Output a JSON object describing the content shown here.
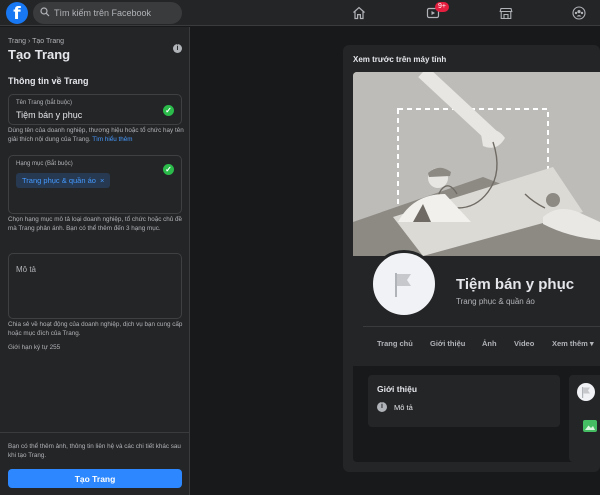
{
  "topbar": {
    "logo": "f",
    "search_placeholder": "Tìm kiếm trên Facebook",
    "nav_icons": [
      "home-icon",
      "watch-icon",
      "marketplace-icon",
      "groups-icon"
    ],
    "watch_badge": "9+"
  },
  "form": {
    "breadcrumb": "Trang › Tạo Trang",
    "title": "Tạo Trang",
    "section_title": "Thông tin về Trang",
    "name_field": {
      "label": "Tên Trang (bắt buộc)",
      "value": "Tiệm bán y phục"
    },
    "name_help": "Dùng tên của doanh nghiệp, thương hiệu hoặc tổ chức hay tên giải thích nội dung của Trang.",
    "name_help_link": "Tìm hiểu thêm",
    "category_field": {
      "label": "Hạng mục (Bắt buộc)",
      "chip": "Trang phục & quần áo",
      "chip_remove": "×"
    },
    "category_help": "Chọn hạng mục mô tả loại doanh nghiệp, tổ chức hoặc chủ đề mà Trang phản ánh. Bạn có thể thêm đến 3 hạng mục.",
    "description_field": {
      "placeholder": "Mô tả"
    },
    "description_help": "Chia sẻ về hoạt động của doanh nghiệp, dịch vụ bạn cung cấp hoặc mục đích của Trang.",
    "char_limit": "Giới hạn ký tự 255",
    "footer_note": "Bạn có thể thêm ảnh, thông tin liên hệ và các chi tiết khác sau khi tạo Trang.",
    "create_button": "Tạo Trang"
  },
  "preview": {
    "label": "Xem trước trên máy tính",
    "page_name": "Tiệm bán y phục",
    "page_category": "Trang phục & quần áo",
    "tabs": [
      "Trang chủ",
      "Giới thiệu",
      "Ảnh",
      "Video",
      "Xem thêm ▾"
    ],
    "about_title": "Giới thiệu",
    "about_item": "Mô tả"
  },
  "colors": {
    "accent": "#2d88ff",
    "success": "#2abb4a",
    "badge": "#e41e3f",
    "background": "#18191a",
    "panel": "#242526"
  }
}
